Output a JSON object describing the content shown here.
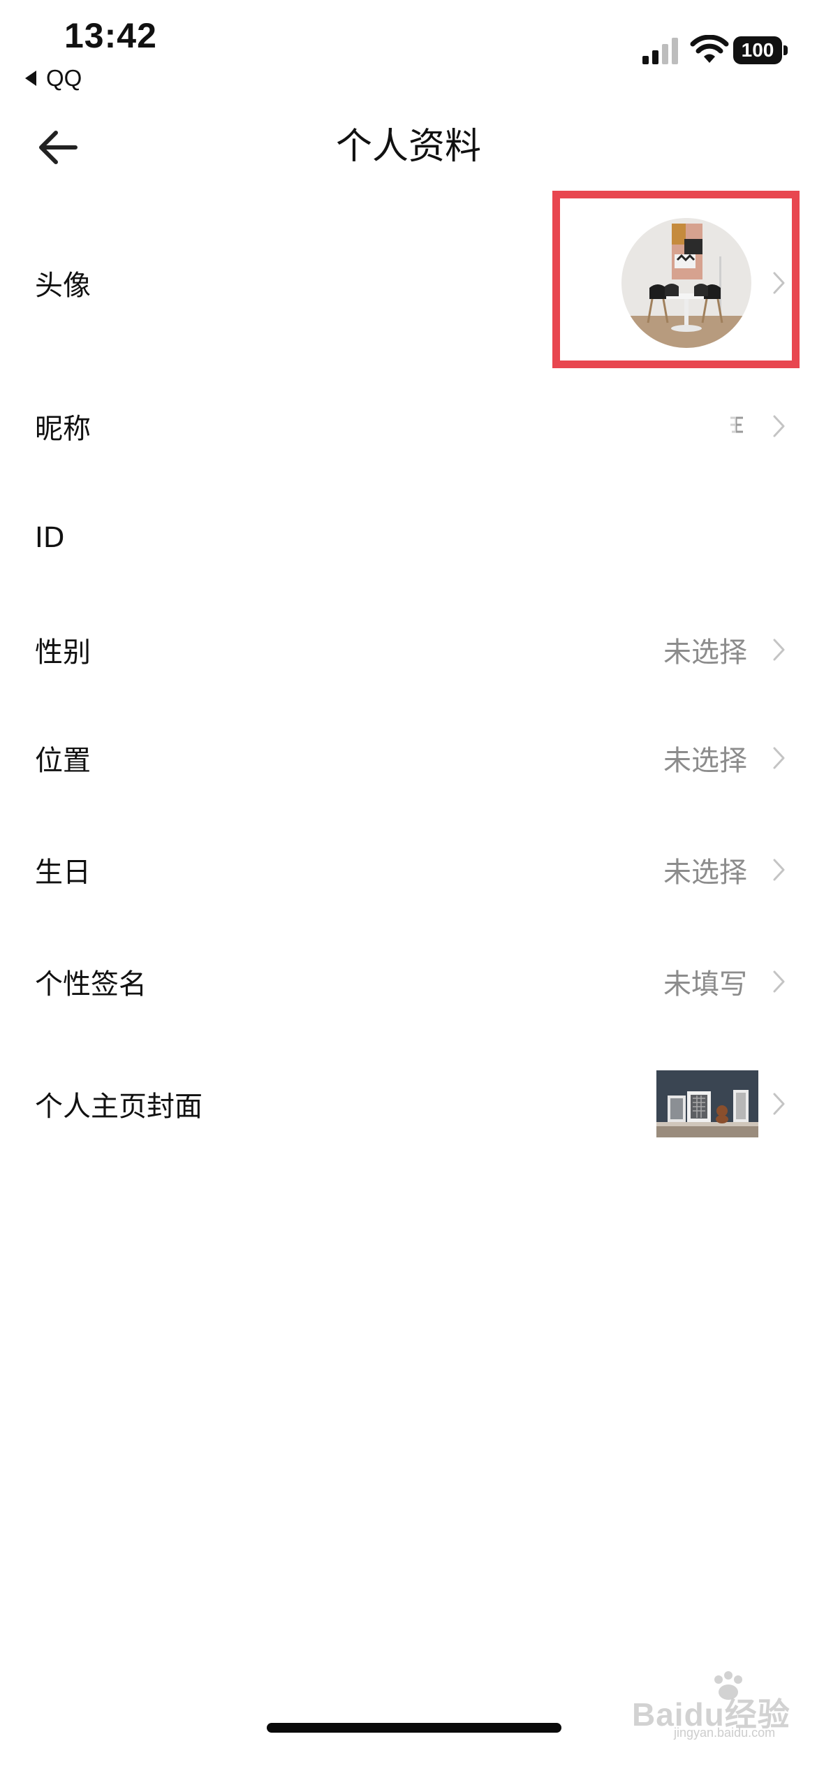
{
  "status_bar": {
    "time": "13:42",
    "back_app": "QQ",
    "battery": "100",
    "icons": [
      "signal-icon",
      "wifi-icon",
      "battery-icon"
    ]
  },
  "nav": {
    "title": "个人资料",
    "back_icon": "back-arrow-icon"
  },
  "rows": {
    "avatar": {
      "label": "头像"
    },
    "nickname": {
      "label": "昵称"
    },
    "id": {
      "label": "ID"
    },
    "gender": {
      "label": "性别",
      "value": "未选择"
    },
    "location": {
      "label": "位置",
      "value": "未选择"
    },
    "birthday": {
      "label": "生日",
      "value": "未选择"
    },
    "signature": {
      "label": "个性签名",
      "value": "未填写"
    },
    "cover": {
      "label": "个人主页封面"
    }
  },
  "highlight": {
    "color": "#e8464f",
    "target": "avatar"
  },
  "watermark": {
    "text": "Baidu经验",
    "sub": "jingyan.baidu.com"
  },
  "colors": {
    "text": "#111111",
    "secondary": "#8c8c8c",
    "chevron": "#c4c4c4",
    "background": "#ffffff"
  }
}
